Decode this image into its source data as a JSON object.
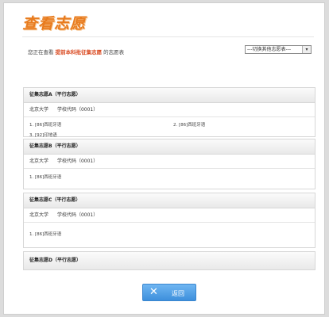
{
  "page": {
    "title": "查看志愿"
  },
  "intro": {
    "prefix": "您正在查看",
    "highlight": "提前本科批征集志愿",
    "suffix": "的志愿表"
  },
  "switch_select": {
    "value": "---切换其他志愿表---"
  },
  "volunteers": [
    {
      "header": "征集志愿A（平行志愿）",
      "school": "北京大学",
      "code": "学校代码（0001）",
      "majors": [
        "1. [86]西班牙语",
        "2. [86]西班牙语",
        "3. [92]印地语"
      ]
    },
    {
      "header": "征集志愿B（平行志愿）",
      "school": "北京大学",
      "code": "学校代码（0001）",
      "majors": [
        "1. [86]西班牙语"
      ]
    },
    {
      "header": "征集志愿C（平行志愿）",
      "school": "北京大学",
      "code": "学校代码（0001）",
      "majors": [
        "1. [86]西班牙语"
      ]
    },
    {
      "header": "征集志愿D（平行志愿）"
    }
  ],
  "buttons": {
    "back": "返回"
  }
}
